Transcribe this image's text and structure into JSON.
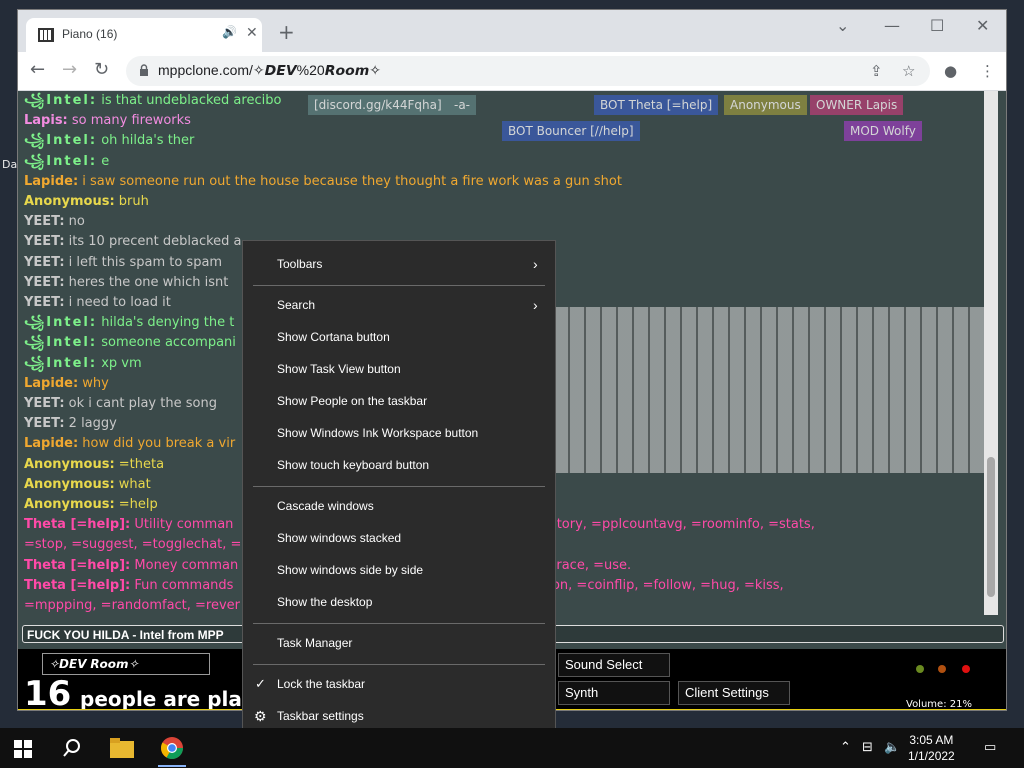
{
  "desktop": {
    "side_label": "Da"
  },
  "browser": {
    "tab_title": "Piano (16)",
    "url": "mppclone.com/✧𝘿𝙀𝙑%20𝙍𝙤𝙤𝙢✧",
    "new_tab": "+"
  },
  "userbar": [
    {
      "text": "[discord.gg/k44Fqha]",
      "color": "#5a7a7a"
    },
    {
      "text": "-a-",
      "color": "#5a7a7a"
    },
    {
      "text": "BOT  Theta [=help]",
      "color": "#3a5aa8"
    },
    {
      "text": "Anonymous",
      "color": "#8a8a40"
    },
    {
      "text": "OWNER  Lapis",
      "color": "#a84070"
    },
    {
      "text": "BOT  Bouncer [//help]",
      "color": "#3a5aa8"
    },
    {
      "text": "MOD  Wolfy",
      "color": "#8a40a8"
    }
  ],
  "chat": [
    {
      "cls": "c-intel",
      "name": "꧁Intel:",
      "text": " is that undeblacked arecibo"
    },
    {
      "cls": "c-lapis",
      "name": "Lapis:",
      "text": " so many fireworks"
    },
    {
      "cls": "c-intel",
      "name": "꧁Intel:",
      "text": " oh hilda's ther"
    },
    {
      "cls": "c-intel",
      "name": "꧁Intel:",
      "text": " e"
    },
    {
      "cls": "c-lapide",
      "name": "Lapide:",
      "text": " i saw someone run out the house because they thought a fire work was a gun shot"
    },
    {
      "cls": "c-anon",
      "name": "Anonymous:",
      "text": " bruh"
    },
    {
      "cls": "c-yeet",
      "name": "YEET:",
      "text": " no"
    },
    {
      "cls": "c-yeet",
      "name": "YEET:",
      "text": " its 10 precent deblacked a"
    },
    {
      "cls": "c-yeet",
      "name": "YEET:",
      "text": " i left this spam to spam"
    },
    {
      "cls": "c-yeet",
      "name": "YEET:",
      "text": " heres the one which isnt"
    },
    {
      "cls": "c-yeet",
      "name": "YEET:",
      "text": " i need to load it"
    },
    {
      "cls": "c-intel",
      "name": "꧁Intel:",
      "text": " hilda's denying the t"
    },
    {
      "cls": "c-intel",
      "name": "꧁Intel:",
      "text": " someone accompani"
    },
    {
      "cls": "c-intel",
      "name": "꧁Intel:",
      "text": " xp vm"
    },
    {
      "cls": "c-lapide",
      "name": "Lapide:",
      "text": " why"
    },
    {
      "cls": "c-yeet",
      "name": "YEET:",
      "text": " ok i cant play the song"
    },
    {
      "cls": "c-yeet",
      "name": "YEET:",
      "text": " 2 laggy"
    },
    {
      "cls": "c-lapide",
      "name": "Lapide:",
      "text": " how did you break a vir"
    },
    {
      "cls": "c-anon",
      "name": "Anonymous:",
      "text": " =theta"
    },
    {
      "cls": "c-anon",
      "name": "Anonymous:",
      "text": " what"
    },
    {
      "cls": "c-anon",
      "name": "Anonymous:",
      "text": " =help"
    },
    {
      "cls": "c-theta",
      "name": "Theta [=help]:",
      "text": " Utility comman                                          eaderboard, =namehistory, =pplcountavg, =roominfo, =stats,"
    },
    {
      "cls": "c-theta",
      "name": "",
      "text": "=stop, =suggest, =togglechat, ="
    },
    {
      "cls": "c-theta",
      "name": "Theta [=help]:",
      "text": " Money comman                                           e, =pay, =sell, =typerace, =use."
    },
    {
      "cls": "c-theta",
      "name": "Theta [=help]:",
      "text": " Fun commands                                           ollow, =cleardescription, =coinflip, =follow, =hug, =kiss,"
    },
    {
      "cls": "c-theta",
      "name": "",
      "text": "=mppping, =randomfact, =rever"
    }
  ],
  "chat_input": "FUCK YOU HILDA - Intel from MPP",
  "bottom": {
    "room": "✧𝘿𝙀𝙑 𝙍𝙤𝙤𝙢✧",
    "count": "16",
    "count_label": "people are pla",
    "sound_select": "Sound Select",
    "synth": "Synth",
    "client_settings": "Client Settings",
    "volume": "Volume: 21%"
  },
  "menu": {
    "toolbars": "Toolbars",
    "search": "Search",
    "cortana": "Show Cortana button",
    "taskview": "Show Task View button",
    "people": "Show People on the taskbar",
    "ink": "Show Windows Ink Workspace button",
    "touch": "Show touch keyboard button",
    "cascade": "Cascade windows",
    "stacked": "Show windows stacked",
    "side": "Show windows side by side",
    "desktop": "Show the desktop",
    "taskmgr": "Task Manager",
    "lock": "Lock the taskbar",
    "settings": "Taskbar settings"
  },
  "taskbar": {
    "time": "3:05 AM",
    "date": "1/1/2022"
  },
  "colors": {
    "menu_bg": "#2b2b2b",
    "taskbar_bg": "#101010",
    "accent_yellow": "#e8d010"
  }
}
